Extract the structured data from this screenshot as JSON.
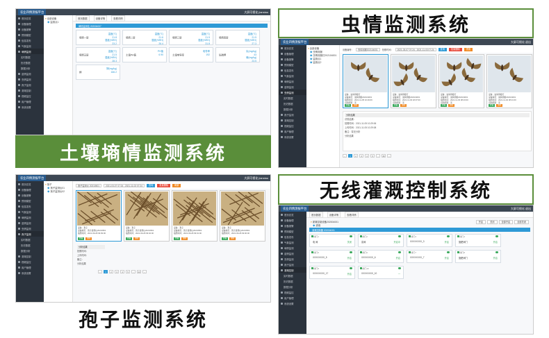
{
  "banners": {
    "soil": "土壤墒情监测系统",
    "insect": "虫情监测系统",
    "spore": "孢子监测系统",
    "irrigation": "无线灌溉控制系统"
  },
  "app": {
    "title": "农业四情测报平台",
    "user": "jianxiao",
    "logout": "退出",
    "user_menu": "大屏可视化"
  },
  "sidebar": [
    "首页总览",
    "设备管理",
    "设备报警",
    "预测模型",
    "信息发布",
    "气象监测",
    "墒情监测",
    "苗情监测",
    "虫情监测",
    "孢子监测",
    "灌溉控制",
    "视频监控",
    "用户管理",
    "系统设置"
  ],
  "sidebar_sub": [
    "实时数据",
    "历史数据",
    "数据分析"
  ],
  "tabs": {
    "home": "首页数据",
    "device": "设备详情",
    "detail": "查看详情"
  },
  "soil": {
    "tree": [
      "全部设备",
      "监测点1"
    ],
    "bluebar": "墒情监测站 202004007",
    "cards": [
      {
        "k": "墒情一层",
        "v": [
          "温度(℃)",
          "21.8",
          "湿度(%RH)",
          "23.2"
        ]
      },
      {
        "k": "墒情二层",
        "v": [
          "温度(℃)",
          "21.6",
          "湿度(%RH)",
          "26.4"
        ]
      },
      {
        "k": "墒情三层",
        "v": [
          "温度(℃)",
          "21.5",
          "湿度(%RH)",
          "31.8"
        ]
      },
      {
        "k": "墒情四层",
        "v": [
          "温度(℃)",
          "21.5",
          "湿度(%RH)",
          "27.3"
        ]
      },
      {
        "k": "墒情五层",
        "v": [
          "温度(℃)",
          "21.5",
          "湿度(%RH)",
          "28.3"
        ]
      },
      {
        "k": "土壤PH值",
        "v": [
          "PH值",
          "6.90"
        ]
      },
      {
        "k": "土壤电导率",
        "v": [
          "电导率",
          "192"
        ]
      },
      {
        "k": "氮磷钾",
        "v": [
          "氮(mg/kg)",
          "43",
          "磷(mg/kg)",
          "23.5"
        ]
      },
      {
        "k": "钾",
        "v": [
          "钾(mg/kg)",
          "166.2"
        ]
      }
    ]
  },
  "insect": {
    "tree": [
      "全部设备",
      "虫情测报",
      "虫情测报灯202104001",
      "监测点1",
      "监测点2"
    ],
    "search": {
      "device_label": "设备编号：",
      "device_value": "虫情测报202104001",
      "date_label": "拍照时间：",
      "date_value": "2021-03-07 07:24 - 2021-11-03 07:24",
      "query": "查询",
      "export": "批量删除",
      "refresh": "刷新",
      "extra": "重置"
    },
    "photos": [
      {
        "a": "设备：虫情测报灯",
        "b": "设备编号：虫情测报202104001",
        "c": "拍照时间：2021-11-05 10:29:06",
        "d": "识别结果：无"
      },
      {
        "a": "设备：虫情测报灯",
        "b": "设备编号：虫情测报202104001",
        "c": "拍照时间：2021-11-03 18:07:00",
        "d": "识别结果：无"
      },
      {
        "a": "设备：虫情测报灯",
        "b": "设备编号：虫情测报202104001",
        "c": "拍照时间：2021-11-03 08:23:00",
        "d": "识别结果：无"
      },
      {
        "a": "设备：虫情测报灯",
        "b": "设备编号：虫情测报202104001",
        "c": "拍照时间：2021-11-02 08:21:00",
        "d": "识别结果：无"
      }
    ],
    "actions": {
      "view": "查看",
      "delete": "删除"
    },
    "detail_title": "分析结果",
    "detail": [
      "识别结果：",
      "拍照时间：2021-11-05 10:29:06",
      "上传时间：2021-11-05 10:29:08",
      "备注：暂无分析",
      "分析结果"
    ],
    "pager": [
      "‹",
      "1",
      "2",
      "3",
      "4",
      "5",
      "...",
      "46",
      "›"
    ]
  },
  "spore": {
    "tree": [
      "孢子",
      "孢子监测仪01",
      "孢子监测仪02"
    ],
    "search": {
      "device_value": "孢子监测仪 20210501",
      "date_value": "2021-03-07 07:24 - 2021-11-03 07:24",
      "query": "查询",
      "export": "批量删除",
      "refresh": "刷新"
    },
    "photos": [
      {
        "a": "设备：孢子",
        "b": "设备编号：孢子监测仪20210501",
        "c": "拍照时间：2021-09-28 09:09:06"
      },
      {
        "a": "设备：孢子",
        "b": "设备编号：孢子监测仪20210501",
        "c": "拍照时间：2021-09-28 09:02:00"
      },
      {
        "a": "设备：孢子",
        "b": "设备编号：孢子监测仪20210501",
        "c": "拍照时间：2021-09-28 09:01:00"
      },
      {
        "a": "设备：孢子",
        "b": "设备编号：孢子监测仪20210501",
        "c": "拍照时间：2021-09-28 09:00:00"
      }
    ],
    "detail_title": "分析结果",
    "detail": [
      "拍照时间：",
      "上传时间：",
      "备注：",
      "分析结果"
    ],
    "pager": [
      "‹",
      "1",
      "2",
      "3",
      "4",
      "5",
      "...",
      "23",
      "›"
    ]
  },
  "irrigation": {
    "tree": [
      "灌溉控制设备202004001",
      "灌溉"
    ],
    "bluebar": "灌溉控制器 202004001",
    "top_btns": [
      "开启",
      "关闭",
      "全部开启",
      "全部关闭"
    ],
    "cards": [
      {
        "h": "阀门1",
        "l": "电 阀",
        "r": "关闭"
      },
      {
        "h": "阀门2",
        "l": "泵阀",
        "r": "开启中"
      },
      {
        "h": "阀门3",
        "l": "XXXXXXXX_3",
        "r": "开启"
      },
      {
        "h": "阀门4",
        "l": "施肥阀门",
        "r": "开启"
      },
      {
        "h": "阀门5",
        "l": "XXXXXXXX_5",
        "r": "开启"
      },
      {
        "h": "阀门6",
        "l": "XXXXXXXX_6",
        "r": "开启"
      },
      {
        "h": "阀门7",
        "l": "XXXXXXXX_7",
        "r": "开启"
      },
      {
        "h": "阀门8",
        "l": "施肥阀门",
        "r": "开启"
      },
      {
        "h": "阀门9",
        "l": "XXXXXXXX_17",
        "r": "开启"
      },
      {
        "h": "阀门10",
        "l": "XXXXXXXX_10",
        "r": "—"
      }
    ]
  }
}
